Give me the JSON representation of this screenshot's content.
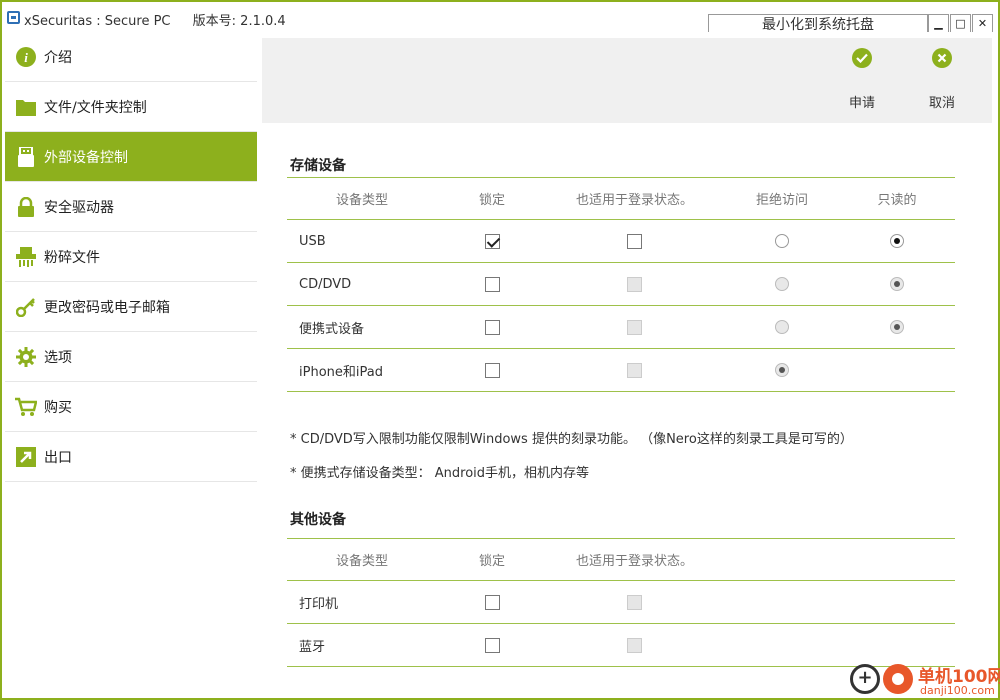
{
  "colors": {
    "accent": "#8db01d",
    "divider": "#9ec14a",
    "watermark": "#e8572a"
  },
  "titlebar": {
    "app_name": "xSecuritas : Secure PC",
    "version": "版本号: 2.1.0.4",
    "tray_button": "最小化到系统托盘",
    "min": "▁",
    "max": "□",
    "close": "✕"
  },
  "sidebar": {
    "items": [
      {
        "label": "介绍",
        "icon": "info-icon"
      },
      {
        "label": "文件/文件夹控制",
        "icon": "folder-icon"
      },
      {
        "label": "外部设备控制",
        "icon": "usb-drive-icon",
        "active": true
      },
      {
        "label": "安全驱动器",
        "icon": "lock-icon"
      },
      {
        "label": "粉碎文件",
        "icon": "shredder-icon"
      },
      {
        "label": "更改密码或电子邮箱",
        "icon": "key-icon"
      },
      {
        "label": "选项",
        "icon": "gear-icon"
      },
      {
        "label": "购买",
        "icon": "cart-icon"
      },
      {
        "label": "出口",
        "icon": "exit-icon"
      }
    ]
  },
  "toolbar": {
    "apply_label": "申请",
    "cancel_label": "取消"
  },
  "storage": {
    "title": "存储设备",
    "headers": {
      "type": "设备类型",
      "lock": "锁定",
      "login": "也适用于登录状态。",
      "deny": "拒绝访问",
      "readonly": "只读的"
    },
    "rows": [
      {
        "name": "USB",
        "lock": true,
        "login": false,
        "login_disabled": false,
        "deny": false,
        "deny_disabled": false,
        "readonly": true,
        "readonly_disabled": false,
        "has_readonly": true
      },
      {
        "name": "CD/DVD",
        "lock": false,
        "login": false,
        "login_disabled": true,
        "deny": false,
        "deny_disabled": true,
        "readonly": true,
        "readonly_disabled": true,
        "has_readonly": true
      },
      {
        "name": "便携式设备",
        "lock": false,
        "login": false,
        "login_disabled": true,
        "deny": false,
        "deny_disabled": true,
        "readonly": true,
        "readonly_disabled": true,
        "has_readonly": true
      },
      {
        "name": "iPhone和iPad",
        "lock": false,
        "login": false,
        "login_disabled": true,
        "deny": true,
        "deny_disabled": true,
        "readonly": false,
        "readonly_disabled": true,
        "has_readonly": false
      }
    ]
  },
  "notes": [
    "* CD/DVD写入限制功能仅限制Windows 提供的刻录功能。 （像Nero这样的刻录工具是可写的）",
    "* 便携式存储设备类型：  Android手机，相机内存等"
  ],
  "other": {
    "title": "其他设备",
    "headers": {
      "type": "设备类型",
      "lock": "锁定",
      "login": "也适用于登录状态。"
    },
    "rows": [
      {
        "name": "打印机",
        "lock": false,
        "login": false,
        "login_disabled": true
      },
      {
        "name": "蓝牙",
        "lock": false,
        "login": false,
        "login_disabled": true
      }
    ]
  },
  "watermark": {
    "glyph": "+",
    "text": "单机100网",
    "domain": "danji100.com"
  }
}
